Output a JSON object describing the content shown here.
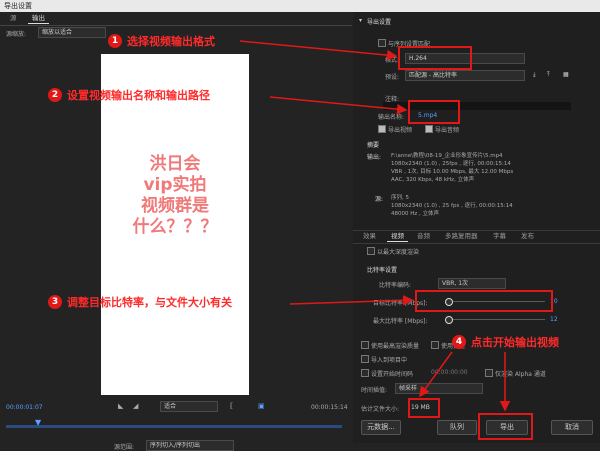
{
  "window": {
    "title": "导出设置"
  },
  "left": {
    "tabs": [
      "源",
      "输出"
    ],
    "scale_label": "源缩放:",
    "scale_value": "缩放以适合",
    "preview_text": "洪日会\nvip实拍\n视频群是\n什么？？？",
    "timecode_start": "00:00:01:07",
    "timecode_end": "00:00:15:14",
    "fit_value": "适合",
    "range_label": "源范围:",
    "range_value": "序列切入/序列切出"
  },
  "right": {
    "export_header": "导出设置",
    "match_seq": "与序列设置匹配",
    "format_label": "格式:",
    "format_value": "H.264",
    "preset_label": "预设:",
    "preset_value": "匹配源 - 高比特率",
    "comment_label": "注释:",
    "output_name_label": "输出名称:",
    "output_name_value": "5.mp4",
    "export_video": "导出视频",
    "export_audio": "导出音频",
    "summary_header": "摘要",
    "output_label": "输出:",
    "output_lines": [
      "F:\\anne\\教程\\08-19_企业形象宣传片\\5.mp4",
      "1080x2340 (1.0) , 25fps , 逐行, 00:00:15:14",
      "VBR , 1次, 目标 10.00 Mbps, 最大 12.00 Mbps",
      "AAC, 320 Kbps, 48 kHz, 立体声"
    ],
    "source_label": "源:",
    "source_lines": [
      "序列, 5",
      "1080x2340 (1.0) , 25 fps , 逐行, 00:00:15:14",
      "48000 Hz , 立体声"
    ],
    "tabs2": [
      "效果",
      "视频",
      "音频",
      "多路复用器",
      "字幕",
      "发布"
    ],
    "render_max_depth": "以最大深度渲染",
    "bitrate_header": "比特率设置",
    "bitrate_encoding_label": "比特率编码:",
    "bitrate_encoding_value": "VBR, 1次",
    "target_bitrate_label": "目标比特率 [Mbps]:",
    "target_bitrate_value": "10",
    "max_bitrate_label": "最大比特率 [Mbps]:",
    "max_bitrate_value": "12",
    "use_max_render": "使用最高渲染质量",
    "use_preview": "使用预览",
    "import_project": "导入到项目中",
    "set_start_timecode": "设置开始时间码",
    "timecode_value": "00:00:00:00",
    "render_alpha": "仅渲染 Alpha 通道",
    "time_interp_label": "时间插值:",
    "time_interp_value": "帧采样",
    "est_size_label": "估计文件大小:",
    "est_size_value": "19 MB",
    "metadata_btn": "元数据...",
    "queue_btn": "队列",
    "export_btn": "导出",
    "cancel_btn": "取消"
  },
  "callouts": [
    {
      "num": "1",
      "text": "选择视频输出格式"
    },
    {
      "num": "2",
      "text": "设置视频输出名称和输出路径"
    },
    {
      "num": "3",
      "text": "调整目标比特率，与文件大小有关"
    },
    {
      "num": "4",
      "text": "点击开始输出视频"
    }
  ],
  "colors": {
    "accent_red": "#e01818",
    "link_blue": "#5aa0ff",
    "panel": "#232323"
  }
}
